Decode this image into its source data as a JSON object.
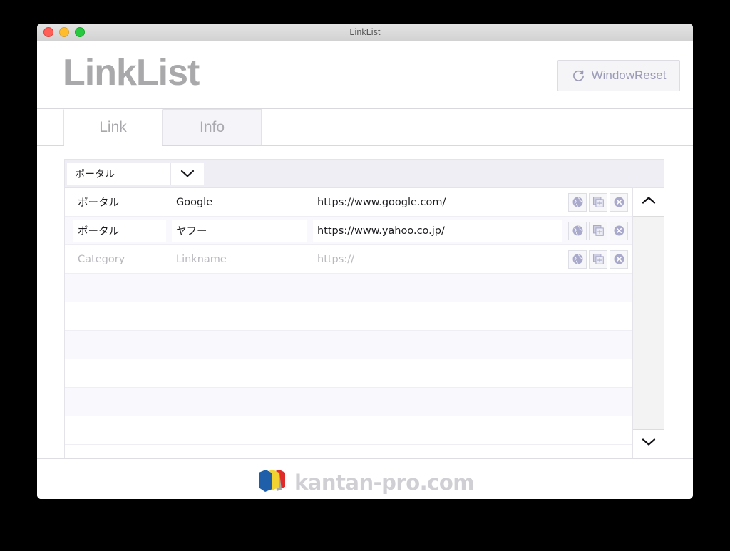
{
  "window": {
    "title": "LinkList",
    "traffic_lights": [
      "close",
      "minimize",
      "maximize"
    ]
  },
  "header": {
    "brand": "LinkList",
    "reset_button": {
      "label": "WindowReset",
      "icon": "refresh-icon"
    }
  },
  "tabs": [
    {
      "label": "Link",
      "active": true
    },
    {
      "label": "Info",
      "active": false
    }
  ],
  "filter": {
    "selected": "ポータル",
    "arrow_icon": "chevron-down-icon"
  },
  "table": {
    "column_placeholders": {
      "category": "Category",
      "linkname": "Linkname",
      "url": "https://"
    },
    "rows": [
      {
        "category": "ポータル",
        "linkname": "Google",
        "url": "https://www.google.com/",
        "is_placeholder": false,
        "boxed": false
      },
      {
        "category": "ポータル",
        "linkname": "ヤフー",
        "url": "https://www.yahoo.co.jp/",
        "is_placeholder": false,
        "boxed": true
      },
      {
        "category": "Category",
        "linkname": "Linkname",
        "url": "https://",
        "is_placeholder": true,
        "boxed": false
      }
    ],
    "row_actions": [
      {
        "name": "open-in-browser",
        "icon": "globe-icon"
      },
      {
        "name": "duplicate-row",
        "icon": "add-square-icon"
      },
      {
        "name": "delete-row",
        "icon": "close-circle-icon"
      }
    ],
    "empty_row_count": 6
  },
  "scrollbar": {
    "up_icon": "chevron-up-icon",
    "down_icon": "chevron-down-icon"
  },
  "footer": {
    "logo_text": "kantan-pro.com",
    "logo_icon": "folders-icon"
  },
  "colors": {
    "accent": "#9a9ab8",
    "brand_gray": "#a9a9ab",
    "row_alt": "#f9f9fd",
    "filter_bar": "#eeeef4",
    "logo_blue": "#1f5fa9",
    "logo_yellow": "#f2d230",
    "logo_red": "#e02b2b",
    "logo_text": "#cfcfd4"
  }
}
